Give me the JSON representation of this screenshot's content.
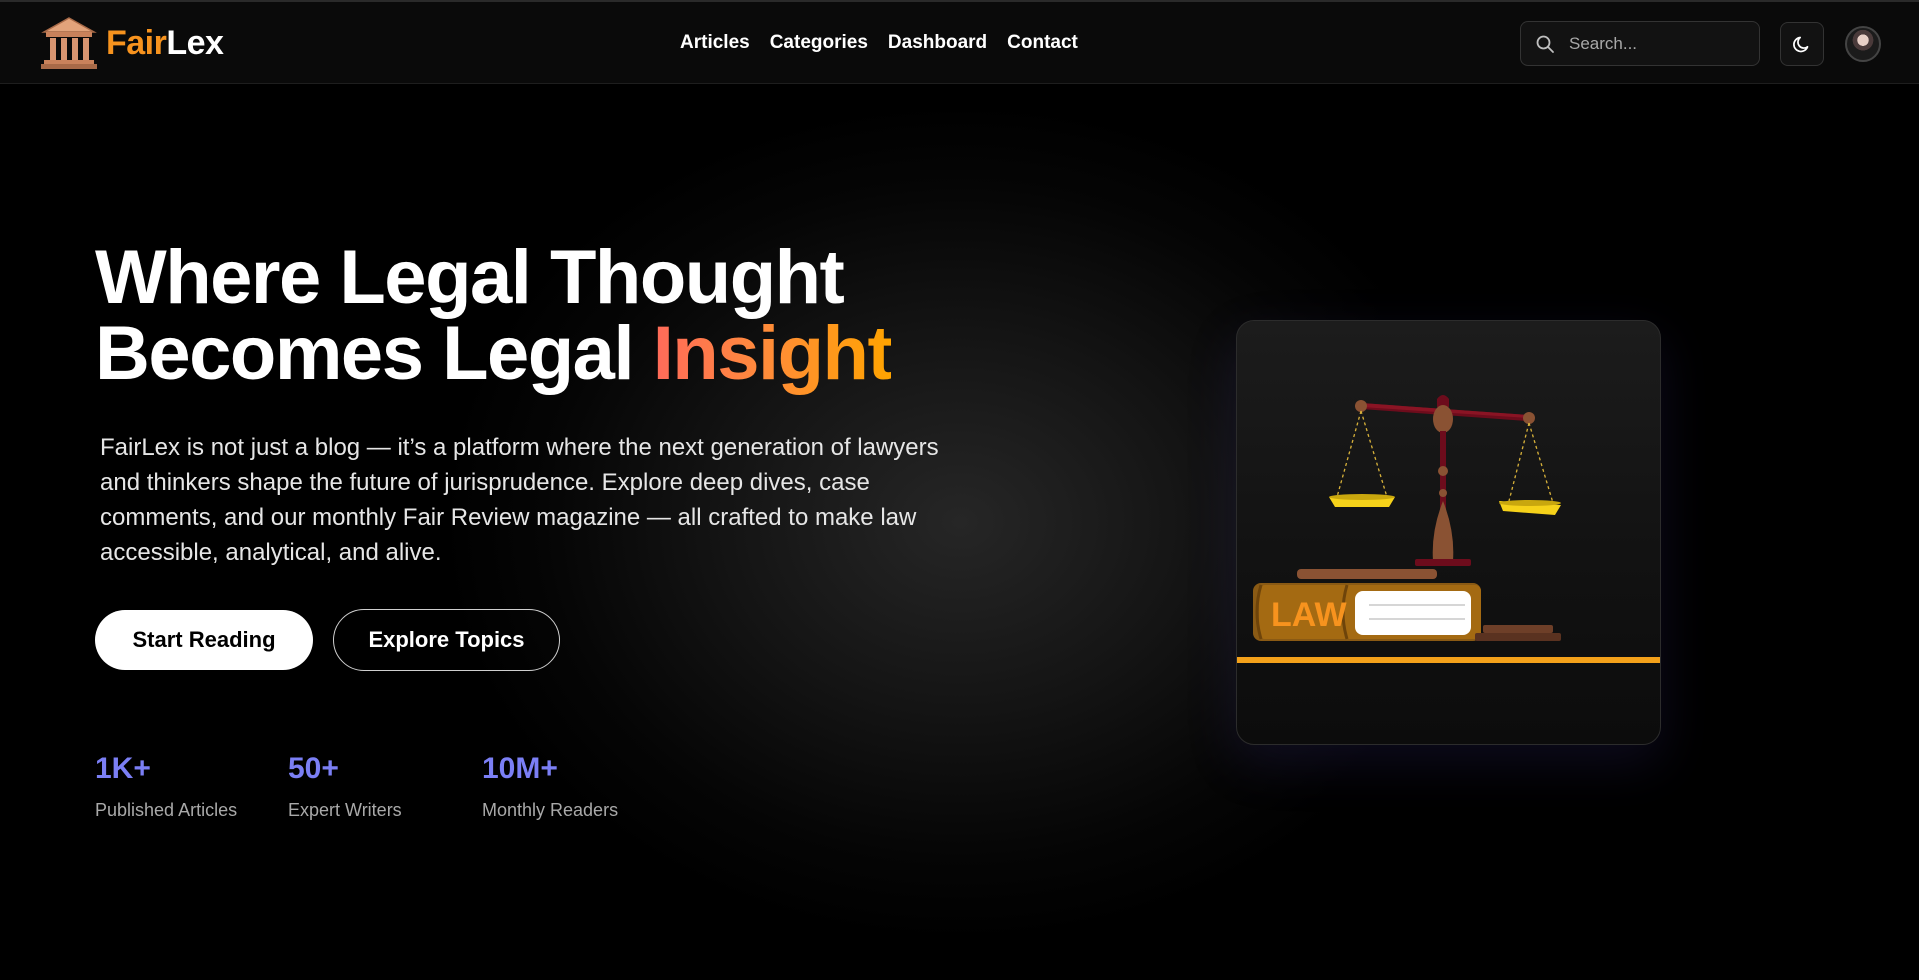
{
  "navbar": {
    "brand": {
      "part1": "Fair",
      "part2": "Lex",
      "icon": "courthouse-icon"
    },
    "links": [
      "Articles",
      "Categories",
      "Dashboard",
      "Contact"
    ],
    "search": {
      "placeholder": "Search...",
      "value": "",
      "icon": "search-icon"
    },
    "theme_toggle_icon": "moon-icon"
  },
  "hero": {
    "title_line1": "Where Legal Thought",
    "title_line2_prefix": "Becomes Legal ",
    "title_accent": "Insight",
    "description": "FairLex is not just a blog — it’s a platform where the next generation of lawyers and thinkers shape the future of jurisprudence. Explore deep dives, case comments, and our monthly Fair Review magazine — all crafted to make law accessible, analytical, and alive.",
    "primary_button": "Start Reading",
    "secondary_button": "Explore Topics"
  },
  "stats": [
    {
      "value": "1K+",
      "label": "Published Articles"
    },
    {
      "value": "50+",
      "label": "Expert Writers"
    },
    {
      "value": "10M+",
      "label": "Monthly Readers"
    }
  ],
  "illustration": {
    "book_label": "LAW",
    "icon": "scales-of-justice-illustration"
  },
  "colors": {
    "brand_orange": "#f7931e",
    "accent_gradient_start": "#ff6a5a",
    "accent_gradient_end": "#ffa400",
    "stat_purple": "#7b7ff5"
  }
}
